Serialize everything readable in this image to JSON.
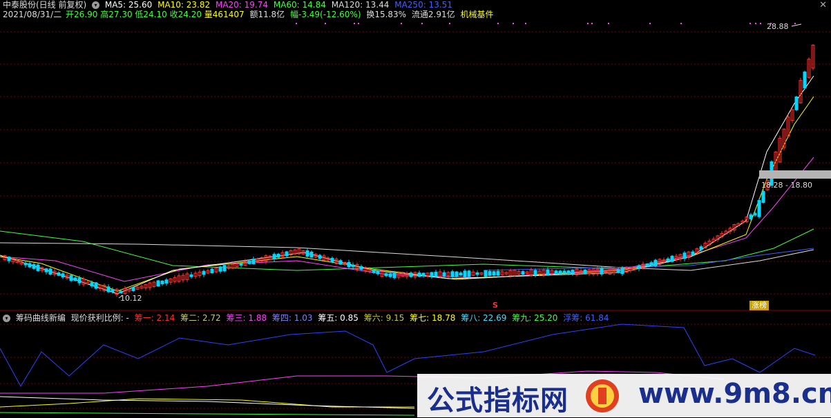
{
  "header": {
    "stock_title": "中泰股份(日线 前复权)",
    "ma": [
      {
        "label": "MA5: 25.60",
        "color": "#ffffff"
      },
      {
        "label": "MA10: 23.82",
        "color": "#ffff00"
      },
      {
        "label": "MA20: 19.74",
        "color": "#ff40ff"
      },
      {
        "label": "MA60: 14.84",
        "color": "#40ff40"
      },
      {
        "label": "MA120: 13.44",
        "color": "#dddddd"
      },
      {
        "label": "MA250: 13.51",
        "color": "#4060ff"
      }
    ],
    "close_icon": "close-x-icon"
  },
  "info": {
    "date": "2021/08/31/二",
    "open": "开26.90",
    "high": "高27.30",
    "low": "低24.10",
    "close": "收24.20",
    "volume": "量461407",
    "amount": "额11.8亿",
    "change": "幅-3.49(-12.60%)",
    "turnover": "换15.83%",
    "float_cap": "流通2.91亿",
    "sector": "机械基件"
  },
  "annotations": {
    "high_price": "28.88",
    "low_price": "10.12",
    "price_range": "18.28 - 18.80",
    "s_marker": "S",
    "hot_tag": "涨榜"
  },
  "indicator": {
    "title": "筹码曲线新编",
    "subtitle": "现价获利比例: -",
    "values": [
      {
        "label": "筹一: 2.14",
        "color": "#ff3030"
      },
      {
        "label": "筹二: 2.72",
        "color": "#c8c870"
      },
      {
        "label": "筹三: 1.88",
        "color": "#ff40ff"
      },
      {
        "label": "筹四: 1.03",
        "color": "#8080ff"
      },
      {
        "label": "筹五: 0.85",
        "color": "#ffffff"
      },
      {
        "label": "筹六: 9.15",
        "color": "#c8c830"
      },
      {
        "label": "筹七: 18.78",
        "color": "#ffff00"
      },
      {
        "label": "筹八: 22.69",
        "color": "#40e0ff"
      },
      {
        "label": "筹九: 25.20",
        "color": "#40ff40"
      },
      {
        "label": "浮筹: 61.84",
        "color": "#4060ff"
      }
    ]
  },
  "watermark": {
    "text": "公式指标网",
    "site": "www.9m8.cn",
    "logo": "coin-logo-icon"
  }
}
